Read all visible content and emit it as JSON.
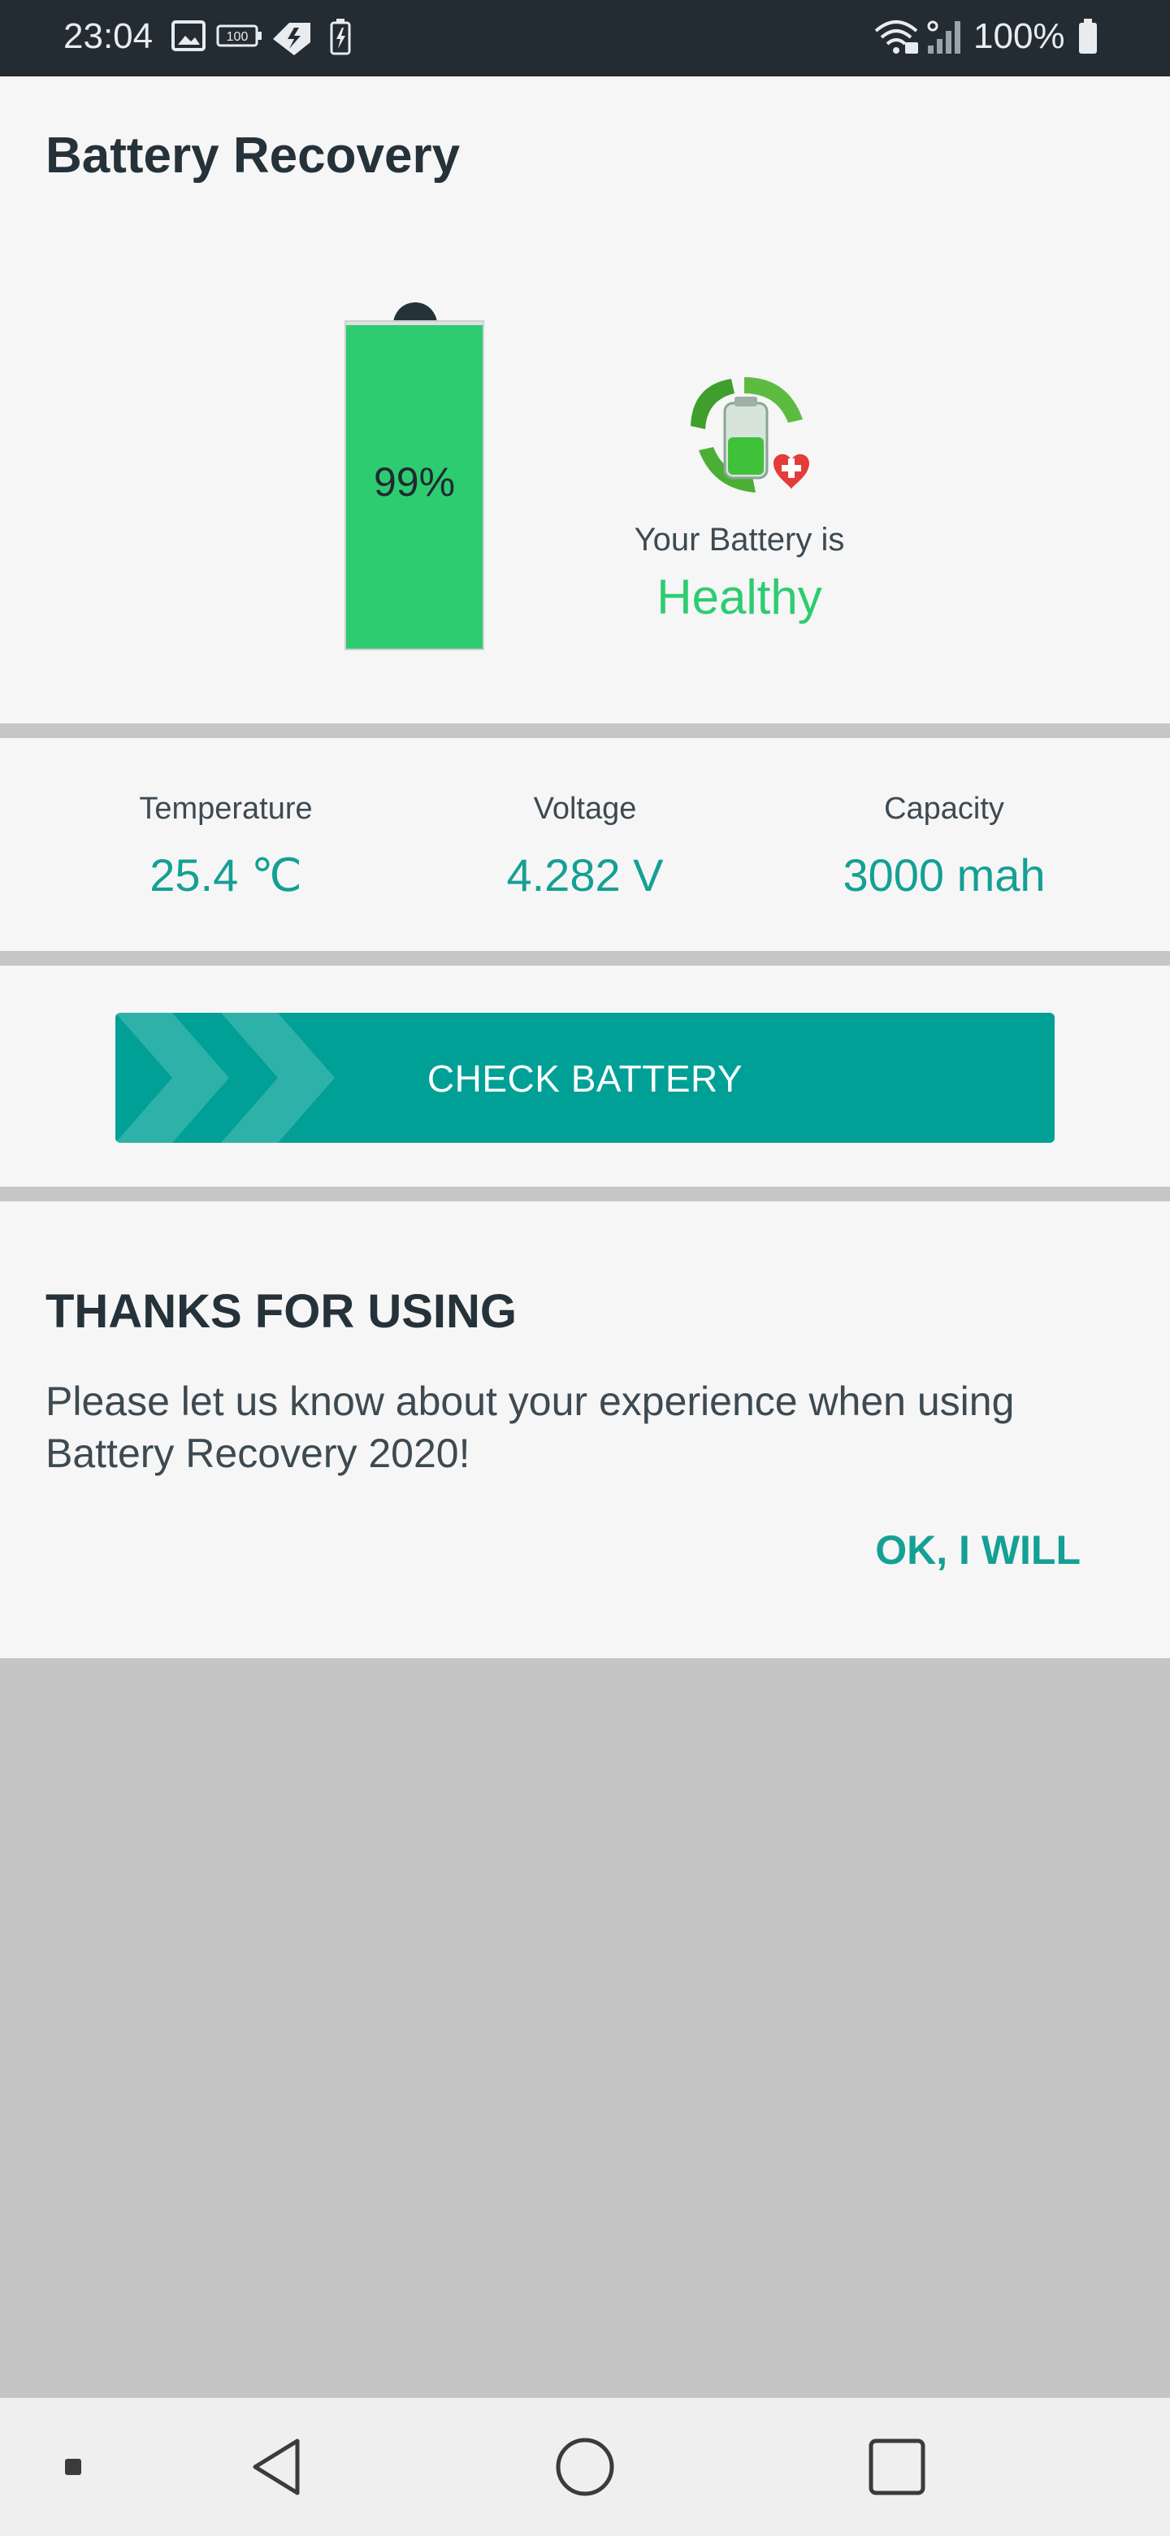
{
  "status_bar": {
    "time": "23:04",
    "battery_percent": "100%",
    "icons": [
      "image-icon",
      "battery-100-icon",
      "tag-bolt-icon",
      "battery-charging-icon",
      "wifi-icon",
      "signal-icon",
      "battery-full-icon"
    ]
  },
  "app": {
    "title": "Battery Recovery"
  },
  "battery": {
    "level_text": "99%",
    "level_fraction": 0.99,
    "status_label": "Your Battery is",
    "status_value": "Healthy"
  },
  "stats": {
    "temperature_label": "Temperature",
    "temperature_value": "25.4 ℃",
    "voltage_label": "Voltage",
    "voltage_value": "4.282 V",
    "capacity_label": "Capacity",
    "capacity_value": "3000 mah"
  },
  "action": {
    "check_label": "CHECK BATTERY"
  },
  "thanks": {
    "title": "THANKS FOR USING",
    "message": "Please let us know about your experience when using Battery Recovery 2020!",
    "ok_label": "OK, I WILL"
  },
  "colors": {
    "accent": "#00a096",
    "healthy": "#2ecc71",
    "status_bar": "#232b33"
  }
}
